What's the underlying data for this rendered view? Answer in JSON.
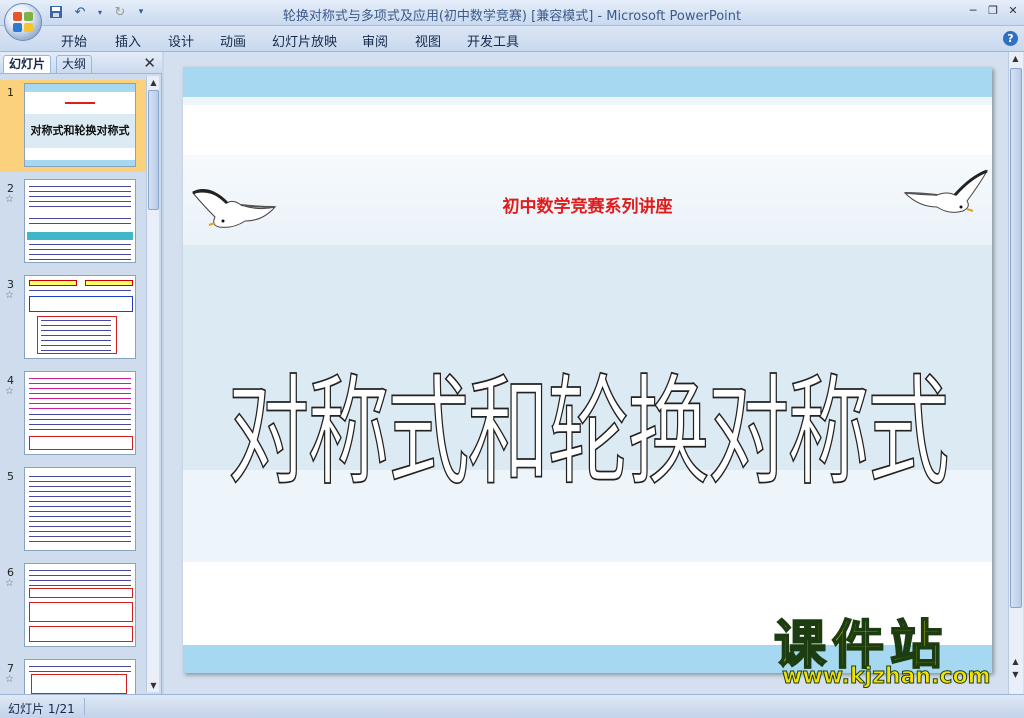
{
  "window": {
    "title": "轮换对称式与多项式及应用(初中数学竞赛) [兼容模式] - Microsoft PowerPoint"
  },
  "quick_access": {
    "icons": [
      "save-icon",
      "undo-icon",
      "redo-icon",
      "customize-icon"
    ]
  },
  "ribbon": {
    "tabs": [
      "开始",
      "插入",
      "设计",
      "动画",
      "幻灯片放映",
      "审阅",
      "视图",
      "开发工具"
    ]
  },
  "left_pane": {
    "tab_slides": "幻灯片",
    "tab_outline": "大纲",
    "slides": [
      {
        "num": "1",
        "title": "对称式和轮换对称式",
        "has_star": false,
        "selected": true
      },
      {
        "num": "2",
        "has_star": true,
        "selected": false
      },
      {
        "num": "3",
        "has_star": true,
        "selected": false
      },
      {
        "num": "4",
        "has_star": true,
        "selected": false
      },
      {
        "num": "5",
        "has_star": false,
        "selected": false
      },
      {
        "num": "6",
        "has_star": true,
        "selected": false
      },
      {
        "num": "7",
        "has_star": true,
        "selected": false
      }
    ]
  },
  "slide": {
    "subtitle": "初中数学竞赛系列讲座",
    "title": "对称式和轮换对称式"
  },
  "watermark": {
    "brand": "课件站",
    "url": "www.kjzhan.com"
  },
  "status": {
    "slide_info": "幻灯片 1/21"
  },
  "colors": {
    "band_blue": "#a7d8f2",
    "band_light": "#dbeaf3",
    "subtitle_red": "#e01c1c",
    "selection": "#fbd17c"
  }
}
